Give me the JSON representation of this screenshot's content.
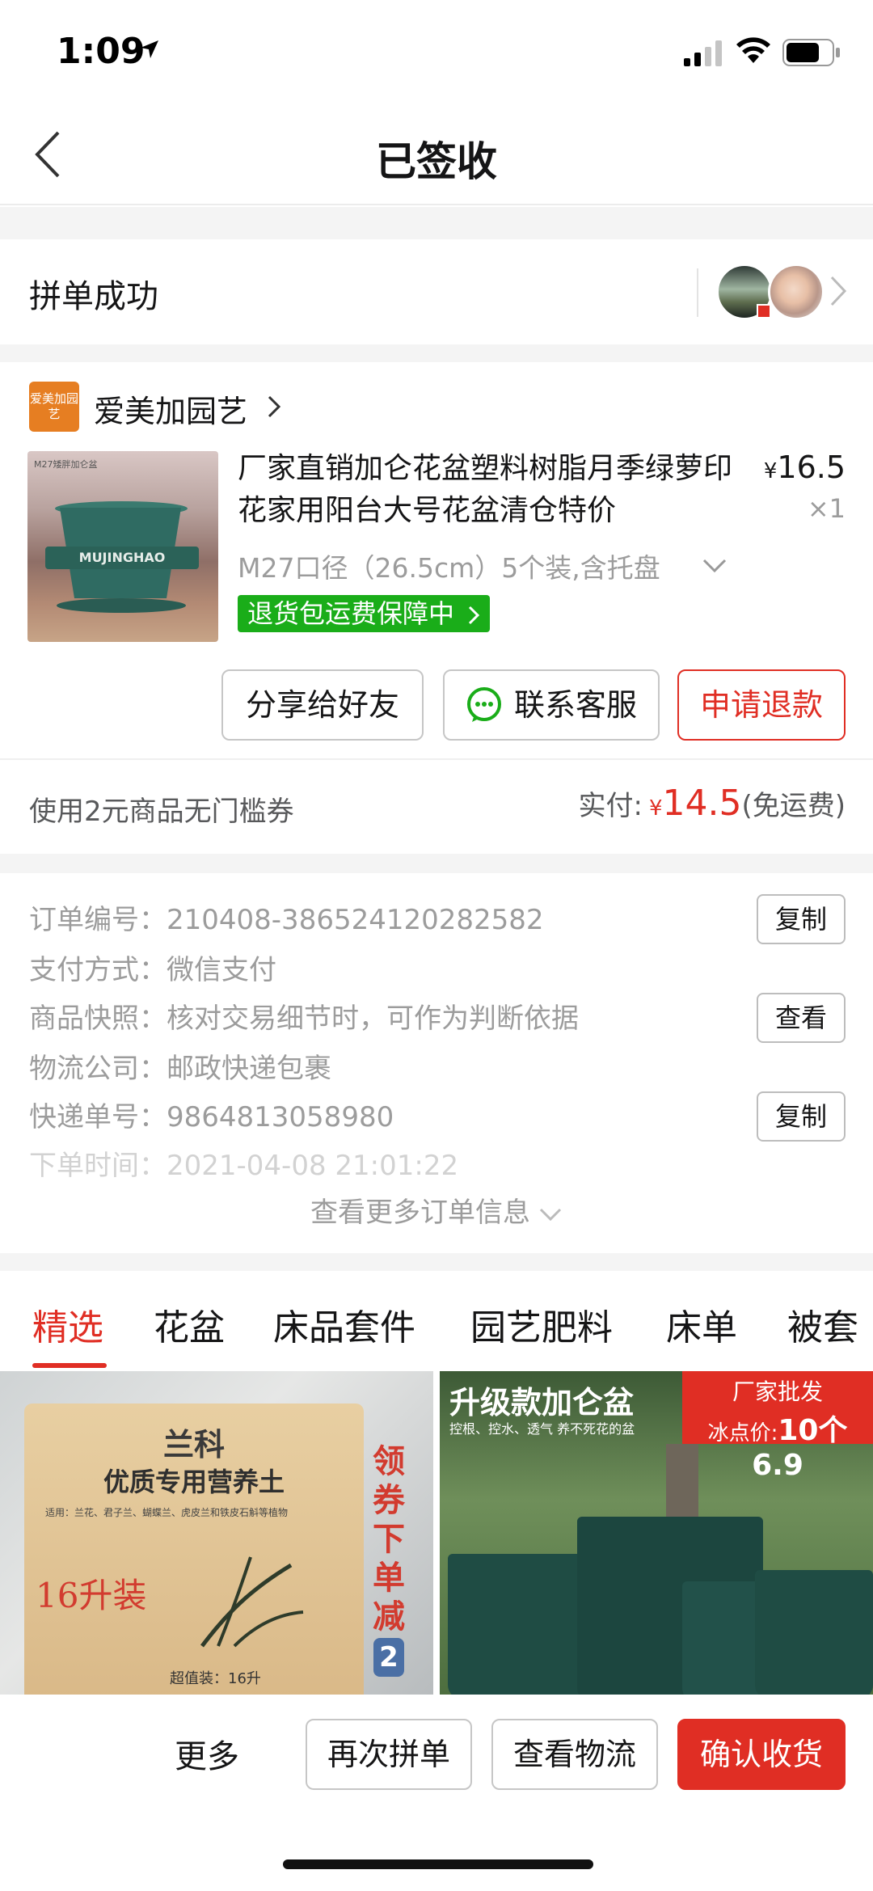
{
  "status_bar": {
    "time": "1:09"
  },
  "nav": {
    "title": "已签收"
  },
  "group": {
    "label": "拼单成功"
  },
  "store": {
    "logo_text": "爱美加园艺",
    "name": "爱美加园艺"
  },
  "product": {
    "thumb_label": "M27矮胖加仑盆",
    "thumb_brand": "MUJINGHAO",
    "title": "厂家直销加仑花盆塑料树脂月季绿萝印花家用阳台大号花盆清仓特价",
    "currency": "¥",
    "price": "16.5",
    "qty": "×1",
    "spec": "M27口径（26.5cm）5个装,含托盘",
    "return_badge": "退货包运费保障中",
    "buttons": {
      "share": "分享给好友",
      "service": "联系客服",
      "refund": "申请退款"
    }
  },
  "coupon": {
    "text": "使用2元商品无门槛券",
    "paid_label": "实付:",
    "paid_currency": "¥",
    "paid_amount": "14.5",
    "shipping": "(免运费)"
  },
  "order_info": {
    "rows": [
      {
        "key": "订单编号：",
        "value": "210408-386524120282582",
        "button": "复制"
      },
      {
        "key": "支付方式：",
        "value": "微信支付"
      },
      {
        "key": "商品快照：",
        "value": "核对交易细节时，可作为判断依据",
        "button": "查看"
      },
      {
        "key": "物流公司：",
        "value": "邮政快递包裹"
      },
      {
        "key": "快递单号：",
        "value": "9864813058980",
        "button": "复制"
      },
      {
        "key": "下单时间：",
        "value": "2021-04-08 21:01:22"
      }
    ],
    "more": "查看更多订单信息"
  },
  "tabs": [
    "精选",
    "花盆",
    "床品套件",
    "园艺肥料",
    "床单",
    "被套"
  ],
  "recommend": {
    "left": {
      "brand": "兰科",
      "title": "优质专用营养土",
      "small": "适用：兰花、君子兰、蝴蝶兰、虎皮兰和铁皮石斛等植物",
      "volume": "16升装",
      "value": "超值装：16升",
      "promo_chars": [
        "领",
        "券",
        "下",
        "单",
        "减"
      ],
      "promo_num": "2"
    },
    "right": {
      "title": "升级款加仑盆",
      "sub": "控根、控水、透气 养不死花的盆",
      "badge_l1": "厂家批发",
      "badge_l2_prefix": "冰点价:",
      "badge_l2_value": "10个6.9"
    }
  },
  "bottom": {
    "more": "更多",
    "regroup": "再次拼单",
    "logistics": "查看物流",
    "confirm": "确认收货"
  },
  "colors": {
    "accent": "#e02e24",
    "green_badge": "#1aad19",
    "muted": "#9c9c9c"
  }
}
